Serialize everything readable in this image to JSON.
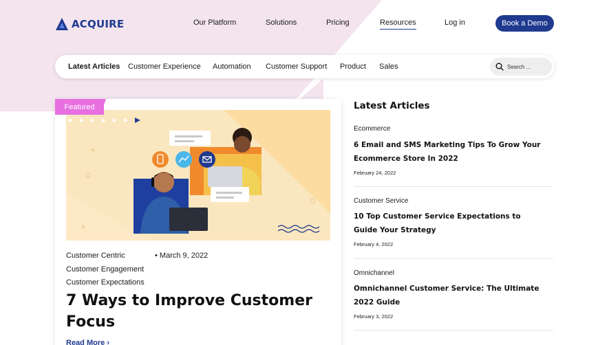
{
  "brand": {
    "logo_text": "ACQUIRE",
    "primary_color": "#1f3a8f",
    "accent_pink": "#e86fe0",
    "bg_pink": "#f3e4ee"
  },
  "nav": {
    "items": [
      {
        "label": "Our Platform"
      },
      {
        "label": "Solutions"
      },
      {
        "label": "Pricing"
      },
      {
        "label": "Resources"
      },
      {
        "label": "Log in"
      }
    ],
    "active": "Resources",
    "cta_label": "Book a Demo"
  },
  "categories": {
    "items": [
      {
        "label": "Latest Articles"
      },
      {
        "label": "Customer Experience"
      },
      {
        "label": "Automation"
      },
      {
        "label": "Customer Support"
      },
      {
        "label": "Product"
      },
      {
        "label": "Sales"
      }
    ],
    "active": "Latest Articles",
    "search_placeholder": "Search ..."
  },
  "featured": {
    "badge": "Featured",
    "tags": [
      "Customer Centric",
      "Customer Engagement",
      "Customer Expectations"
    ],
    "date": "• March 9, 2022",
    "title": "7 Ways to Improve Customer Focus",
    "read_more": "Read More"
  },
  "latest": {
    "heading": "Latest Articles",
    "articles": [
      {
        "category": "Ecommerce",
        "title": "6 Email and SMS Marketing Tips To Grow Your Ecommerce Store In 2022",
        "date": "February 24, 2022"
      },
      {
        "category": "Customer Service",
        "title": "10 Top Customer Service Expectations to Guide Your Strategy",
        "date": "February 4, 2022"
      },
      {
        "category": "Omnichannel",
        "title": "Omnichannel Customer Service: The Ultimate 2022 Guide",
        "date": "February 3, 2022"
      }
    ]
  }
}
